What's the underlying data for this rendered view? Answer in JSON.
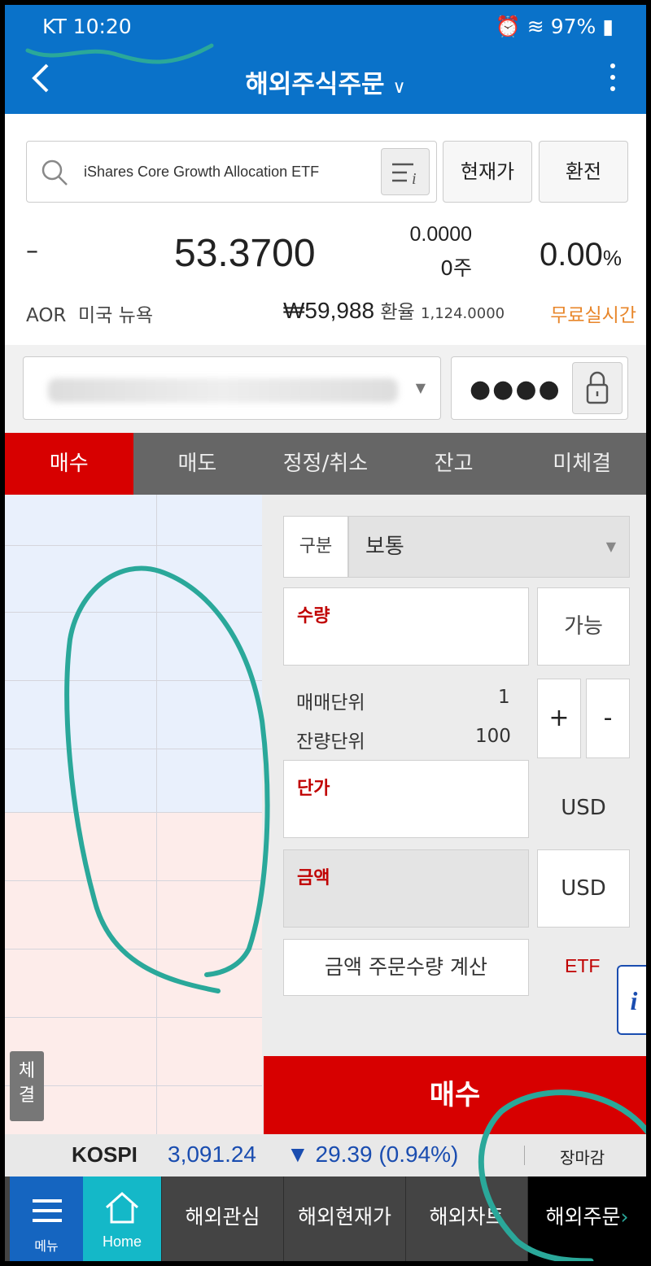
{
  "status_bar": {
    "carrier_time": "KT 10:20",
    "battery": "97%"
  },
  "header": {
    "title": "해외주식주문",
    "back_icon": "chevron-left-icon",
    "more_icon": "kebab-menu-icon"
  },
  "search": {
    "value": "iShares Core Growth Allocation ETF",
    "buttons": [
      "현재가",
      "환전"
    ]
  },
  "quote": {
    "dash": "–",
    "price": "53.3700",
    "change": "0.0000",
    "volume": "0주",
    "percent": "0.00",
    "percent_unit": "%",
    "ticker": "AOR",
    "market": "미국 뉴욕",
    "krw": "₩59,988",
    "fx_label": "환율",
    "fx_value": "1,124.0000",
    "realtime": "무료실시간"
  },
  "account": {
    "password_mask": "●●●●"
  },
  "tabs": [
    "매수",
    "매도",
    "정정/취소",
    "잔고",
    "미체결"
  ],
  "side_tab": "체\n결",
  "order": {
    "type_label": "구분",
    "type_value": "보통",
    "qty_label": "수량",
    "available": "가능",
    "trade_unit_label": "매매단위",
    "trade_unit_value": "1",
    "odd_unit_label": "잔량단위",
    "odd_unit_value": "100",
    "plus": "+",
    "minus": "-",
    "price_label": "단가",
    "price_currency": "USD",
    "amount_label": "금액",
    "amount_currency": "USD",
    "calc_button": "금액 주문수량 계산",
    "etf": "ETF",
    "buy_button": "매수",
    "info_icon": "i"
  },
  "index": {
    "name": "KOSPI",
    "value": "3,091.24",
    "change": "▼ 29.39 (0.94%)",
    "market_status": "장마감"
  },
  "nav": {
    "menu": "메뉴",
    "home": "Home",
    "items": [
      "해외관심",
      "해외현재가",
      "해외차트",
      "해외주문"
    ]
  },
  "colors": {
    "header_blue": "#0a72c9",
    "buy_red": "#d70000",
    "index_blue": "#1a4db0",
    "annotation_teal": "#2aa89a"
  }
}
